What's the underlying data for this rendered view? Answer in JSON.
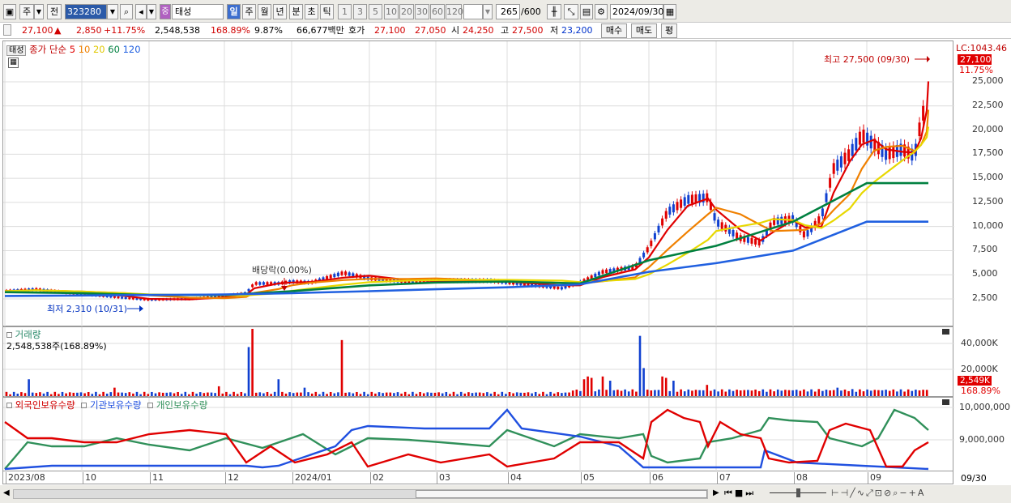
{
  "toolbar": {
    "period_label": "주",
    "prev_label": "전",
    "code": "323280",
    "flag": "중",
    "name": "태성",
    "tabs": [
      "일",
      "주",
      "월",
      "년",
      "분",
      "초",
      "틱"
    ],
    "active_tab": "일",
    "intervals": [
      "1",
      "3",
      "5",
      "10",
      "20",
      "30",
      "60",
      "120"
    ],
    "count": "265",
    "count_total": "/600",
    "date": "2024/09/30"
  },
  "info": {
    "price": "27,100",
    "arrow": "▲",
    "change": "2,850",
    "change_pct": "+11.75%",
    "volume": "2,548,538",
    "vol_ratio": "168.89%",
    "turnover": "9.87%",
    "amount": "66,677백만",
    "quote_label": "호가",
    "ask": "27,100",
    "bid": "27,050",
    "open_label": "시",
    "open": "24,250",
    "high_label": "고",
    "high": "27,500",
    "low_label": "저",
    "low": "23,200",
    "buy": "매수",
    "sell": "매도",
    "eval": "평"
  },
  "price_pane": {
    "stock_tag": "태성",
    "ma_label": "종가 단순",
    "ma_periods": [
      {
        "p": "5",
        "color": "#e00000"
      },
      {
        "p": "10",
        "color": "#f08000"
      },
      {
        "p": "20",
        "color": "#e8d800"
      },
      {
        "p": "60",
        "color": "#008040"
      },
      {
        "p": "120",
        "color": "#2060e0"
      }
    ],
    "lc": "LC:1043.46",
    "last": "27,100",
    "pct": "11.75%",
    "high_note": "최고 27,500 (09/30)",
    "low_note": "최저 2,310 (10/31)",
    "div_note": "배당락(0.00%)",
    "y_ticks": [
      "25,000",
      "22,500",
      "20,000",
      "17,500",
      "15,000",
      "12,500",
      "10,000",
      "7,500",
      "5,000",
      "2,500"
    ]
  },
  "volume_pane": {
    "title": "거래량",
    "value": "2,548,538주(168.89%)",
    "y_ticks": [
      "40,000K",
      "20,000K"
    ],
    "last": "2,549K",
    "pct": "168.89%"
  },
  "holding_pane": {
    "series": [
      {
        "name": "외국인보유수량",
        "color": "#e00000"
      },
      {
        "name": "기관보유수량",
        "color": "#2050e0"
      },
      {
        "name": "개인보유수량",
        "color": "#30905a"
      }
    ],
    "y_ticks": [
      "10,000,000",
      "9,000,000"
    ]
  },
  "x_axis": {
    "labels": [
      "2023/08",
      "10",
      "11",
      "12",
      "2024/01",
      "02",
      "03",
      "04",
      "05",
      "06",
      "07",
      "08",
      "09"
    ],
    "right": "09/30"
  },
  "chart_data": {
    "type": "line",
    "title": "태성",
    "months": [
      "2023/08",
      "2023/10",
      "2023/11",
      "2023/12",
      "2024/01",
      "2024/02",
      "2024/03",
      "2024/04",
      "2024/05",
      "2024/06",
      "2024/07",
      "2024/08",
      "2024/09"
    ],
    "series": [
      {
        "name": "종가",
        "values": [
          3300,
          2900,
          2450,
          3000,
          4300,
          4600,
          4400,
          4300,
          4100,
          13200,
          8000,
          11000,
          27100
        ]
      },
      {
        "name": "60",
        "values": [
          3200,
          3100,
          2900,
          2900,
          3300,
          3900,
          4200,
          4300,
          4100,
          6500,
          8000,
          10500,
          14500
        ]
      },
      {
        "name": "120",
        "values": [
          2800,
          2850,
          2900,
          2950,
          3100,
          3300,
          3500,
          3700,
          4000,
          5300,
          6200,
          7500,
          10500
        ]
      }
    ],
    "ylim": [
      0,
      28000
    ],
    "high": 27500,
    "low": 2310,
    "volume_last_k": 2549,
    "volume_ylim_k": [
      0,
      48000
    ]
  }
}
